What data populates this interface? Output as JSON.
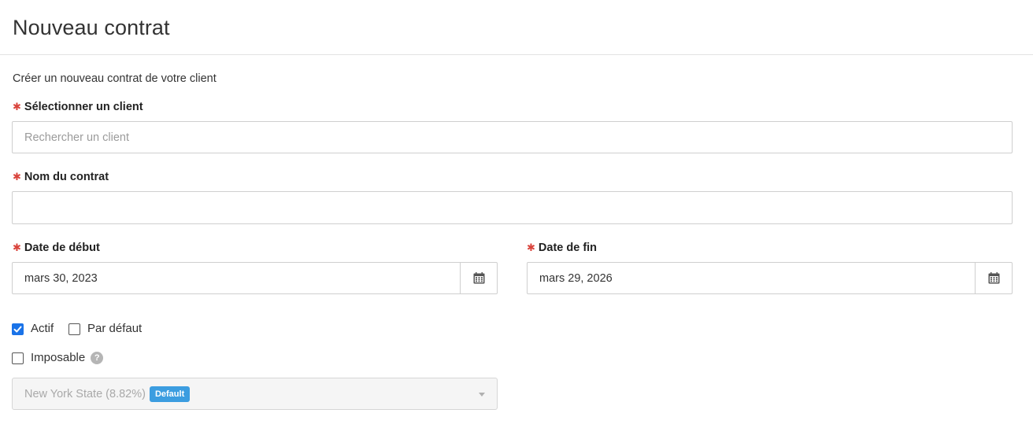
{
  "header": {
    "title": "Nouveau contrat"
  },
  "form": {
    "subtitle": "Créer un nouveau contrat de votre client",
    "required_mark": "✱",
    "client": {
      "label": "Sélectionner un client",
      "placeholder": "Rechercher un client",
      "value": ""
    },
    "contract_name": {
      "label": "Nom du contrat",
      "value": ""
    },
    "start_date": {
      "label": "Date de début",
      "value": "mars 30, 2023",
      "icon": "calendar-icon"
    },
    "end_date": {
      "label": "Date de fin",
      "value": "mars 29, 2026",
      "icon": "calendar-icon"
    },
    "checkboxes": {
      "active": {
        "label": "Actif",
        "checked": true
      },
      "default": {
        "label": "Par défaut",
        "checked": false
      },
      "taxable": {
        "label": "Imposable",
        "checked": false,
        "help": "?"
      }
    },
    "tax_select": {
      "value": "New York State (8.82%)",
      "badge": "Default",
      "disabled": true
    }
  },
  "colors": {
    "required": "#d9433b",
    "checkbox_checked": "#1a73e8",
    "badge": "#3c9de0"
  }
}
